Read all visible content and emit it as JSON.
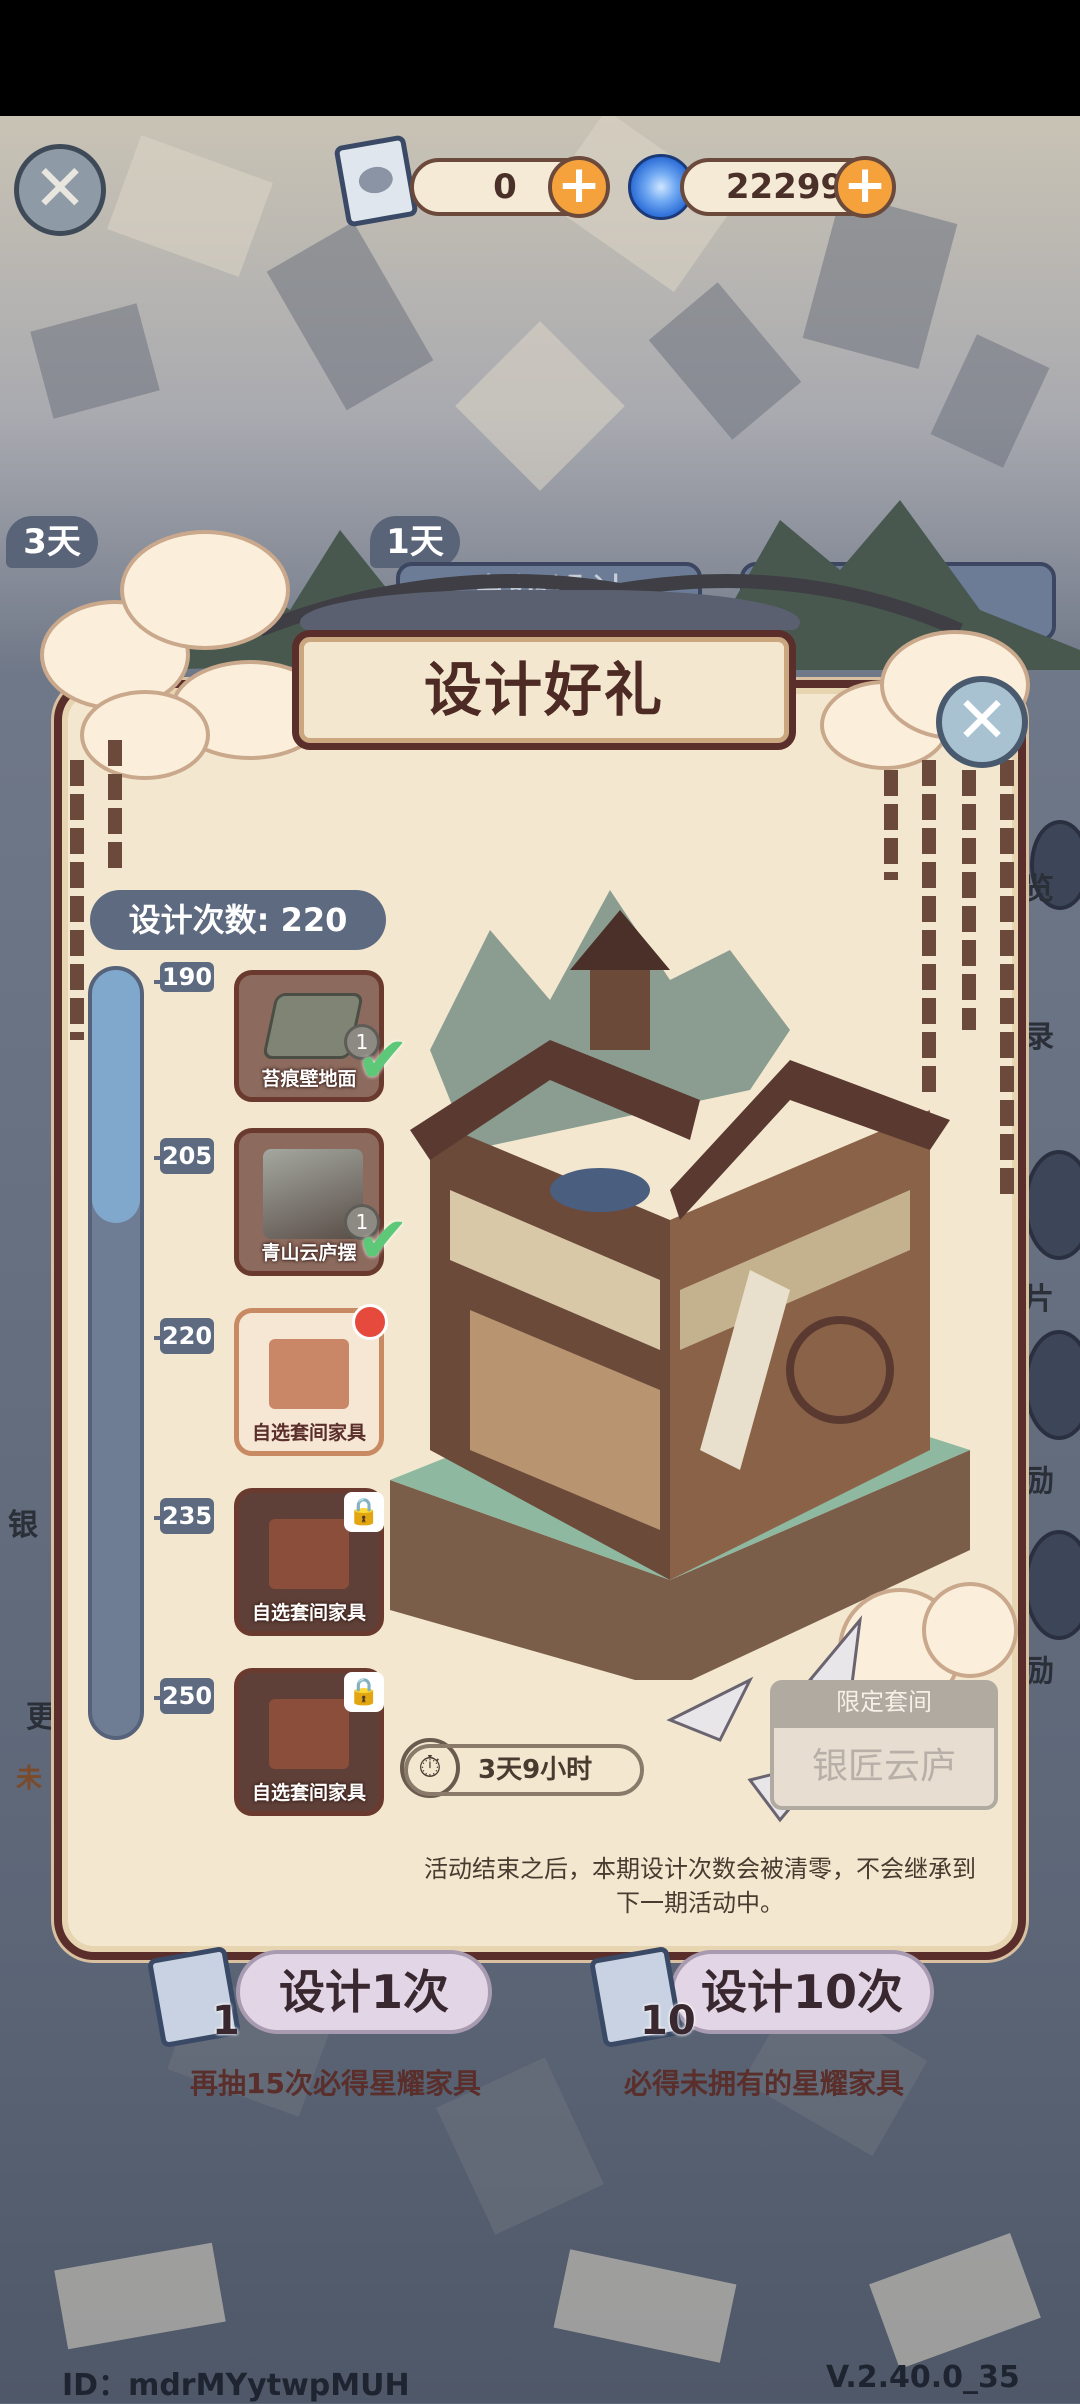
{
  "header": {
    "ticket_count": "0",
    "gem_count": "22299",
    "plus": "+",
    "close": "✕"
  },
  "background_tabs": {
    "badge_left": "3天",
    "badge_mid": "1天",
    "tab_left_partial": "高级设计",
    "tab_right_partial": "设计"
  },
  "side_labels": [
    "览",
    "录",
    "片",
    "励",
    "励"
  ],
  "left_labels": [
    "银",
    "更",
    "未"
  ],
  "modal": {
    "title": "设计好礼",
    "close": "✕",
    "design_count_label": "设计次数: 220",
    "progress": 0.33,
    "milestones": [
      {
        "value": "190",
        "label": "苔痕壁地面",
        "qty": "1",
        "state": "claimed"
      },
      {
        "value": "205",
        "label": "青山云庐摆",
        "qty": "1",
        "state": "claimed"
      },
      {
        "value": "220",
        "label": "自选套间家具",
        "state": "available"
      },
      {
        "value": "235",
        "label": "自选套间家具",
        "state": "locked"
      },
      {
        "value": "250",
        "label": "自选套间家具",
        "state": "locked"
      }
    ],
    "timer": "3天9小时",
    "limited_label": "限定套间",
    "suite_name": "银匠云庐",
    "notice": "活动结束之后，本期设计次数会被清零，不会继承到下一期活动中。"
  },
  "bottom": {
    "draw_one_label": "设计1次",
    "draw_one_cost": "1",
    "draw_one_note": "再抽15次必得星耀家具",
    "draw_ten_label": "设计10次",
    "draw_ten_cost": "10",
    "draw_ten_note": "必得未拥有的星耀家具"
  },
  "footer": {
    "id": "ID：mdrMYytwpMUH",
    "version": "V.2.40.0_35"
  },
  "colors": {
    "frame": "#5a2e2a",
    "parchment": "#f3e8cf",
    "progress_fill": "#7fa8cc",
    "plus_button": "#f5a23c",
    "check": "#5cc878"
  }
}
